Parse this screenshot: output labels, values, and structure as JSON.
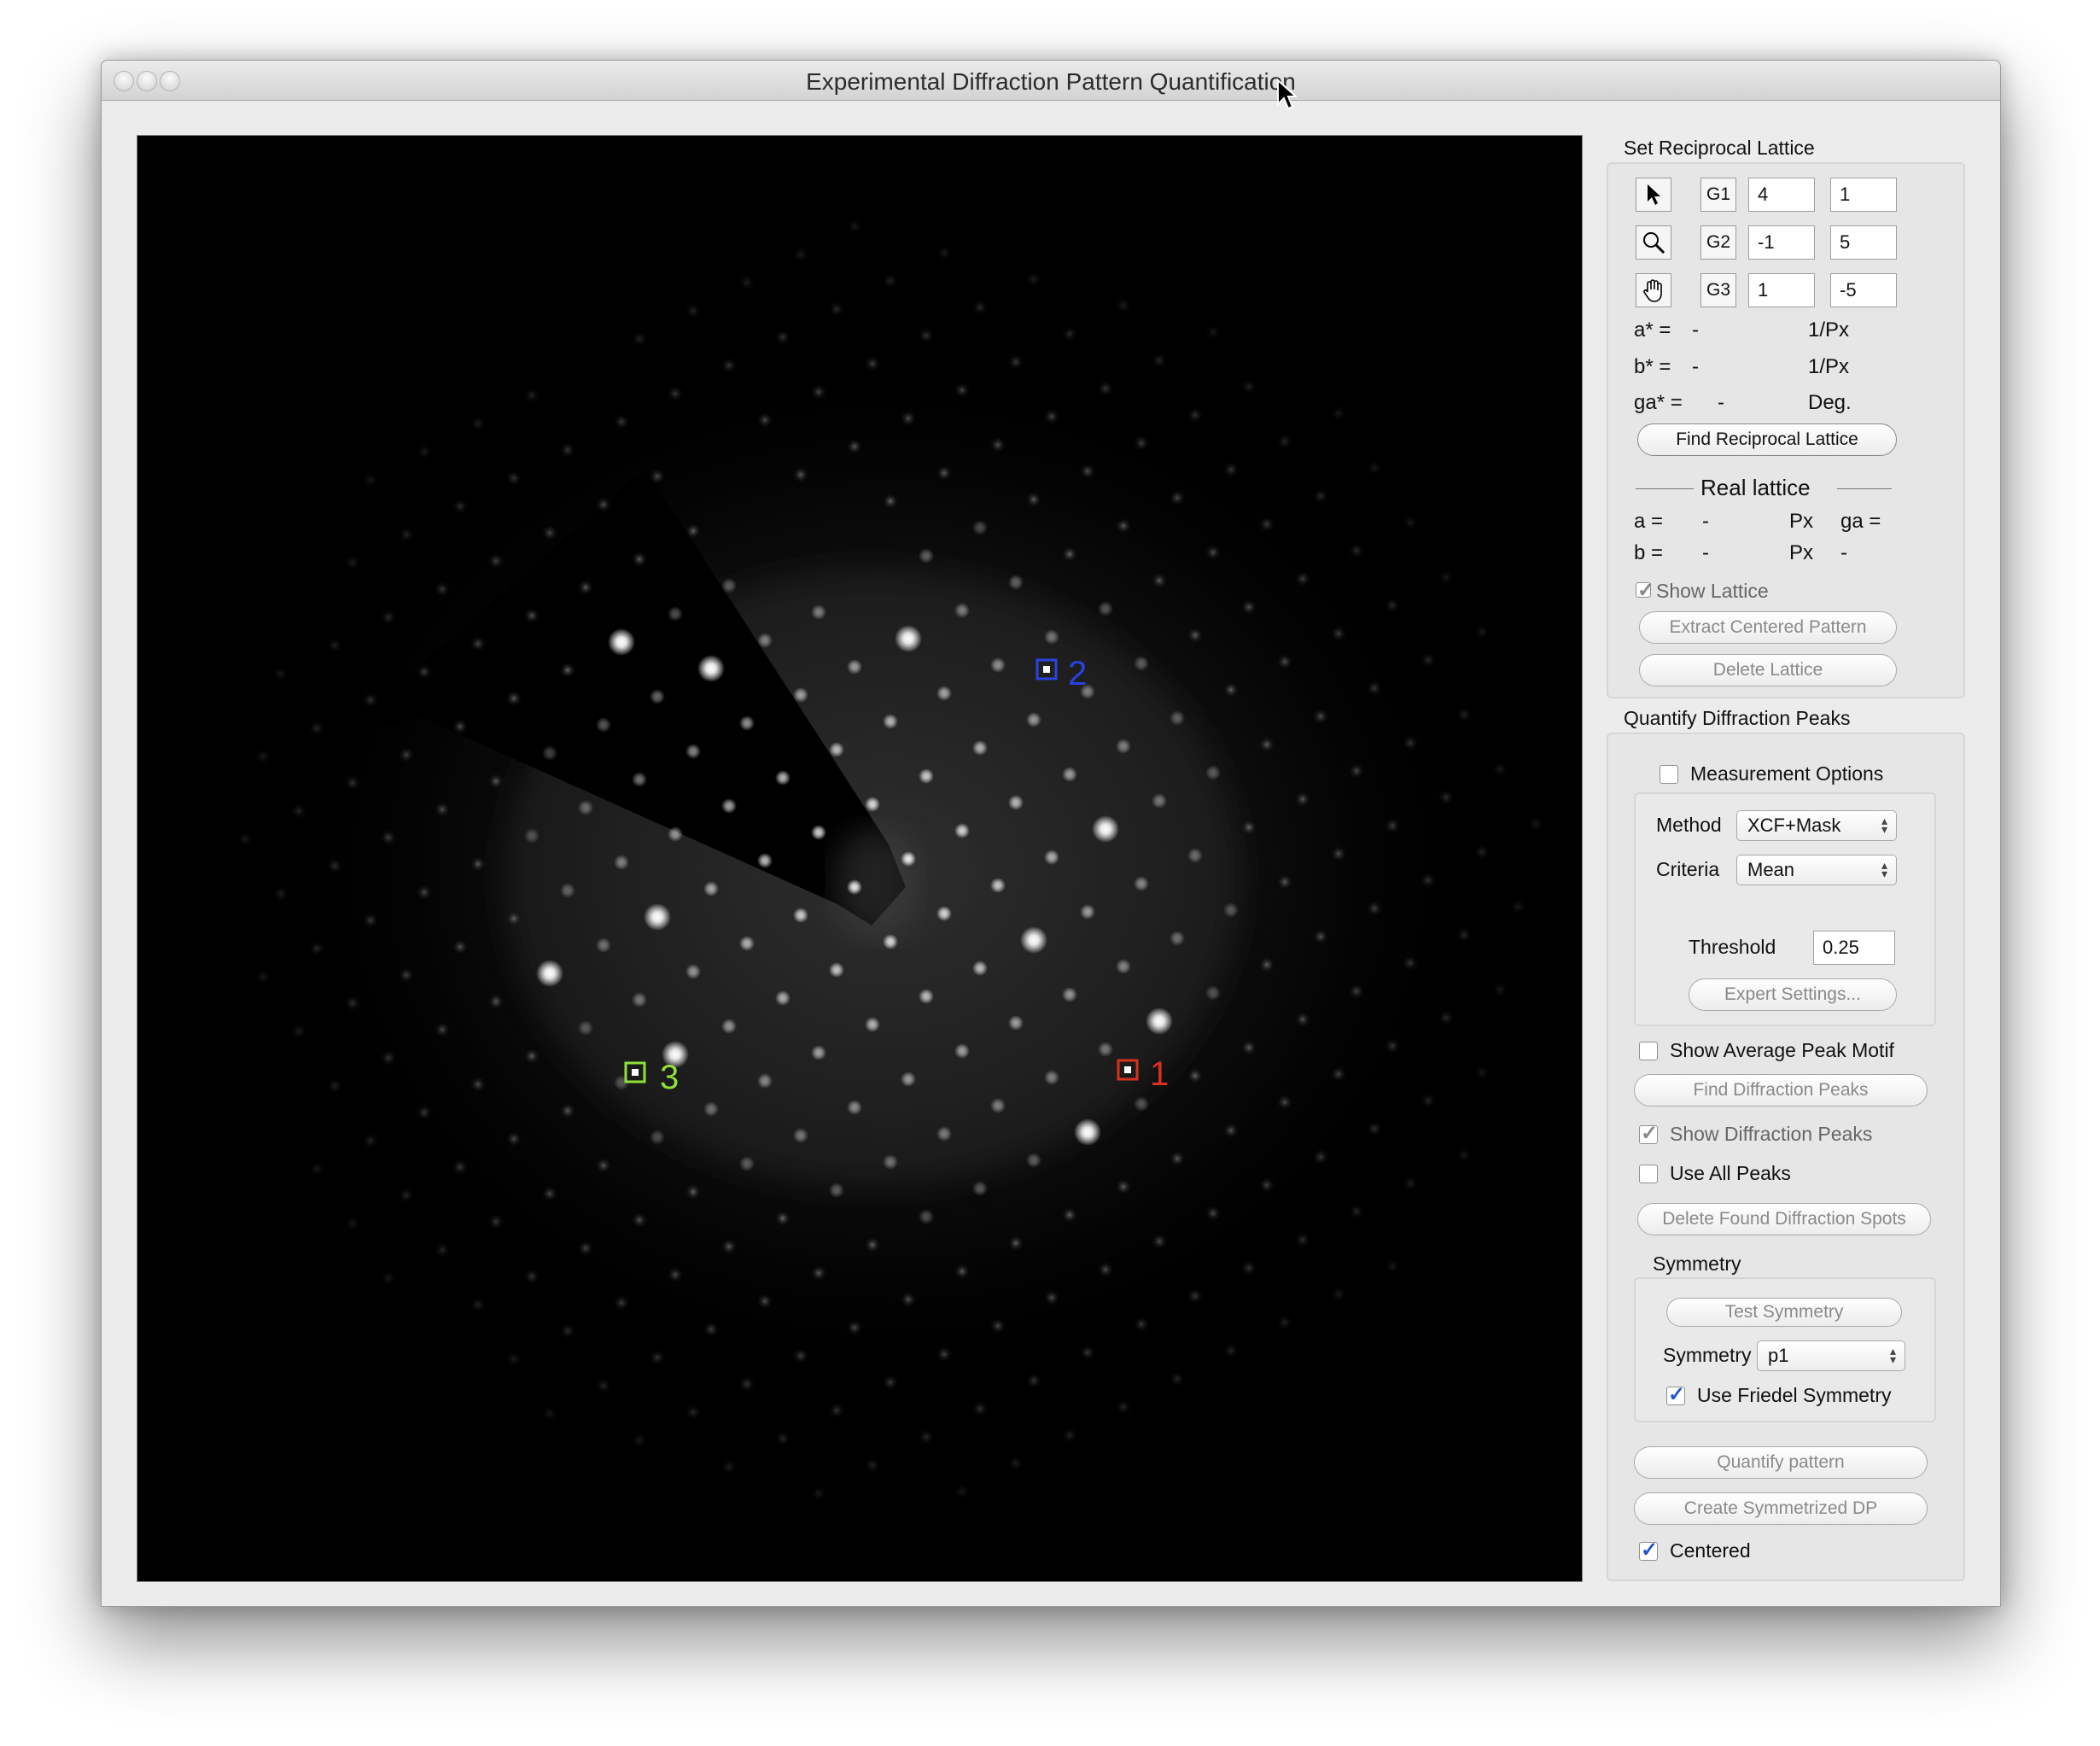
{
  "window": {
    "title": "Experimental Diffraction Pattern Quantification"
  },
  "viewer": {
    "markers": [
      {
        "label": "1",
        "color": "#d9311f"
      },
      {
        "label": "2",
        "color": "#2a43e0"
      },
      {
        "label": "3",
        "color": "#8fe03a"
      }
    ]
  },
  "reciprocal_lattice": {
    "section_title": "Set Reciprocal Lattice",
    "tools": [
      "pointer-icon",
      "zoom-icon",
      "hand-icon"
    ],
    "vectors": [
      {
        "label": "G1",
        "h": "4",
        "k": "1"
      },
      {
        "label": "G2",
        "h": "-1",
        "k": "5"
      },
      {
        "label": "G3",
        "h": "1",
        "k": "-5"
      }
    ],
    "a_star": {
      "label": "a* =",
      "value": "-",
      "unit": "1/Px"
    },
    "b_star": {
      "label": "b* =",
      "value": "-",
      "unit": "1/Px"
    },
    "ga_star": {
      "label": "ga* =",
      "value": "-",
      "unit": "Deg."
    },
    "find_button": "Find Reciprocal Lattice",
    "real_lattice": {
      "title": "Real lattice",
      "a": {
        "label": "a =",
        "value": "-",
        "unit": "Px"
      },
      "b": {
        "label": "b =",
        "value": "-",
        "unit": "Px"
      },
      "ga": {
        "label": "ga =",
        "value": "-"
      }
    },
    "show_lattice": {
      "label": "Show Lattice",
      "checked": true
    },
    "extract_button": "Extract Centered Pattern",
    "delete_button": "Delete Lattice"
  },
  "quantify": {
    "section_title": "Quantify Diffraction Peaks",
    "measurement_options": {
      "label": "Measurement Options",
      "checked": false
    },
    "method": {
      "label": "Method",
      "value": "XCF+Mask"
    },
    "criteria": {
      "label": "Criteria",
      "value": "Mean"
    },
    "threshold": {
      "label": "Threshold",
      "value": "0.25"
    },
    "expert_button": "Expert Settings...",
    "show_average": {
      "label": "Show Average Peak Motif",
      "checked": false
    },
    "find_peaks_button": "Find Diffraction Peaks",
    "show_peaks": {
      "label": "Show Diffraction Peaks",
      "checked": true
    },
    "use_all": {
      "label": "Use All Peaks",
      "checked": false
    },
    "delete_spots_button": "Delete Found Diffraction Spots",
    "symmetry": {
      "title": "Symmetry",
      "test_button": "Test Symmetry",
      "label": "Symmetry",
      "value": "p1",
      "friedel": {
        "label": "Use Friedel Symmetry",
        "checked": true
      }
    },
    "quantify_button": "Quantify pattern",
    "symmetrized_button": "Create Symmetrized DP",
    "centered": {
      "label": "Centered",
      "checked": true
    }
  }
}
